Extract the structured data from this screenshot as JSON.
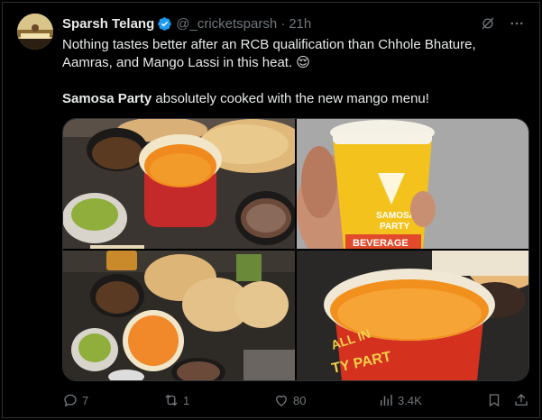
{
  "author": {
    "name": "Sparsh Telang",
    "handle": "@_cricketsparsh",
    "separator": "·",
    "time": "21h"
  },
  "tweet": {
    "line1": "Nothing tastes better after an RCB qualification than Chhole Bhature,",
    "line2": "Aamras, and Mango Lassi in this heat. 😌",
    "line3_bold": "Samosa Party",
    "line3_rest": " absolutely cooked with the new mango menu!"
  },
  "media": [
    {
      "alt": "photo-food-top-left"
    },
    {
      "alt": "photo-cup-top-right",
      "cup_text": [
        "SAMOSA",
        "PARTY",
        "BEVERAGE"
      ]
    },
    {
      "alt": "photo-food-bottom-left"
    },
    {
      "alt": "photo-cup-bottom-right",
      "cup_text": [
        "ALL IN",
        "TY PART"
      ]
    }
  ],
  "actions": {
    "replies": "7",
    "reposts": "1",
    "likes": "80",
    "views": "3.4K"
  },
  "colors": {
    "background": "#000000",
    "text": "#e7e9ea",
    "muted": "#71767b",
    "verified": "#1d9bf0",
    "border": "#2f3336"
  }
}
